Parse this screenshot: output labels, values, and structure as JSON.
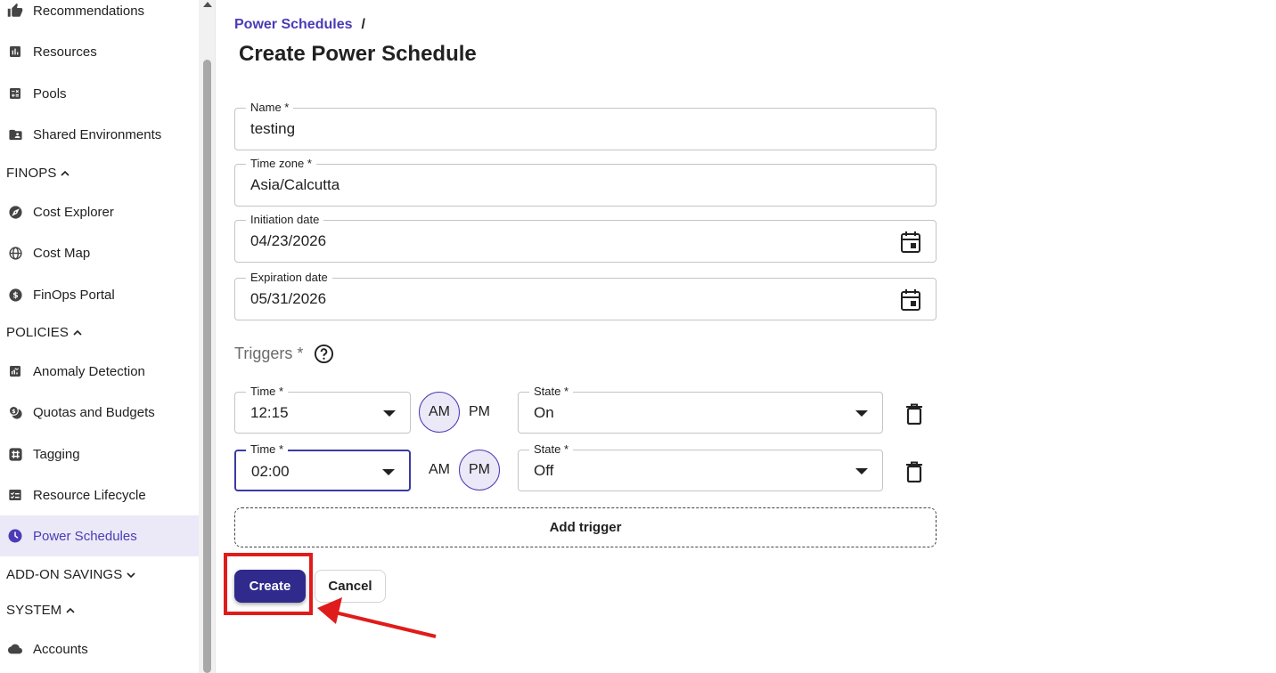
{
  "sidebar": {
    "items": [
      {
        "label": "Recommendations",
        "icon": "thumbs-up-icon"
      },
      {
        "label": "Resources",
        "icon": "bar-chart-icon"
      },
      {
        "label": "Pools",
        "icon": "calculator-icon"
      },
      {
        "label": "Shared Environments",
        "icon": "folder-user-icon"
      },
      {
        "label": "Cost Explorer",
        "icon": "compass-icon"
      },
      {
        "label": "Cost Map",
        "icon": "globe-icon"
      },
      {
        "label": "FinOps Portal",
        "icon": "dollar-icon"
      },
      {
        "label": "Anomaly Detection",
        "icon": "trend-chart-icon"
      },
      {
        "label": "Quotas and Budgets",
        "icon": "coins-icon"
      },
      {
        "label": "Tagging",
        "icon": "hash-icon"
      },
      {
        "label": "Resource Lifecycle",
        "icon": "checklist-icon"
      },
      {
        "label": "Power Schedules",
        "icon": "clock-icon",
        "active": true
      },
      {
        "label": "Accounts",
        "icon": "cloud-icon"
      }
    ],
    "sections": {
      "finops": "FINOPS",
      "policies": "POLICIES",
      "addon": "ADD-ON SAVINGS",
      "system": "SYSTEM"
    }
  },
  "breadcrumb": {
    "parent": "Power Schedules",
    "separator": "/"
  },
  "page_title": "Create Power Schedule",
  "form": {
    "name": {
      "label": "Name *",
      "value": "testing"
    },
    "timezone": {
      "label": "Time zone *",
      "value": "Asia/Calcutta"
    },
    "initiation": {
      "label": "Initiation date",
      "value": "04/23/2026"
    },
    "expiration": {
      "label": "Expiration date",
      "value": "05/31/2026"
    }
  },
  "triggers": {
    "label": "Triggers *",
    "rows": [
      {
        "time_label": "Time *",
        "time": "12:15",
        "am": "AM",
        "pm": "PM",
        "selected": "AM",
        "state_label": "State *",
        "state": "On"
      },
      {
        "time_label": "Time *",
        "time": "02:00",
        "am": "AM",
        "pm": "PM",
        "selected": "PM",
        "state_label": "State *",
        "state": "Off"
      }
    ],
    "add_label": "Add trigger"
  },
  "buttons": {
    "create": "Create",
    "cancel": "Cancel"
  },
  "colors": {
    "accent": "#4a3bb6",
    "primary_button": "#2f2a8c",
    "annotation": "#e01b1b",
    "active_bg": "#ebe9f7"
  }
}
